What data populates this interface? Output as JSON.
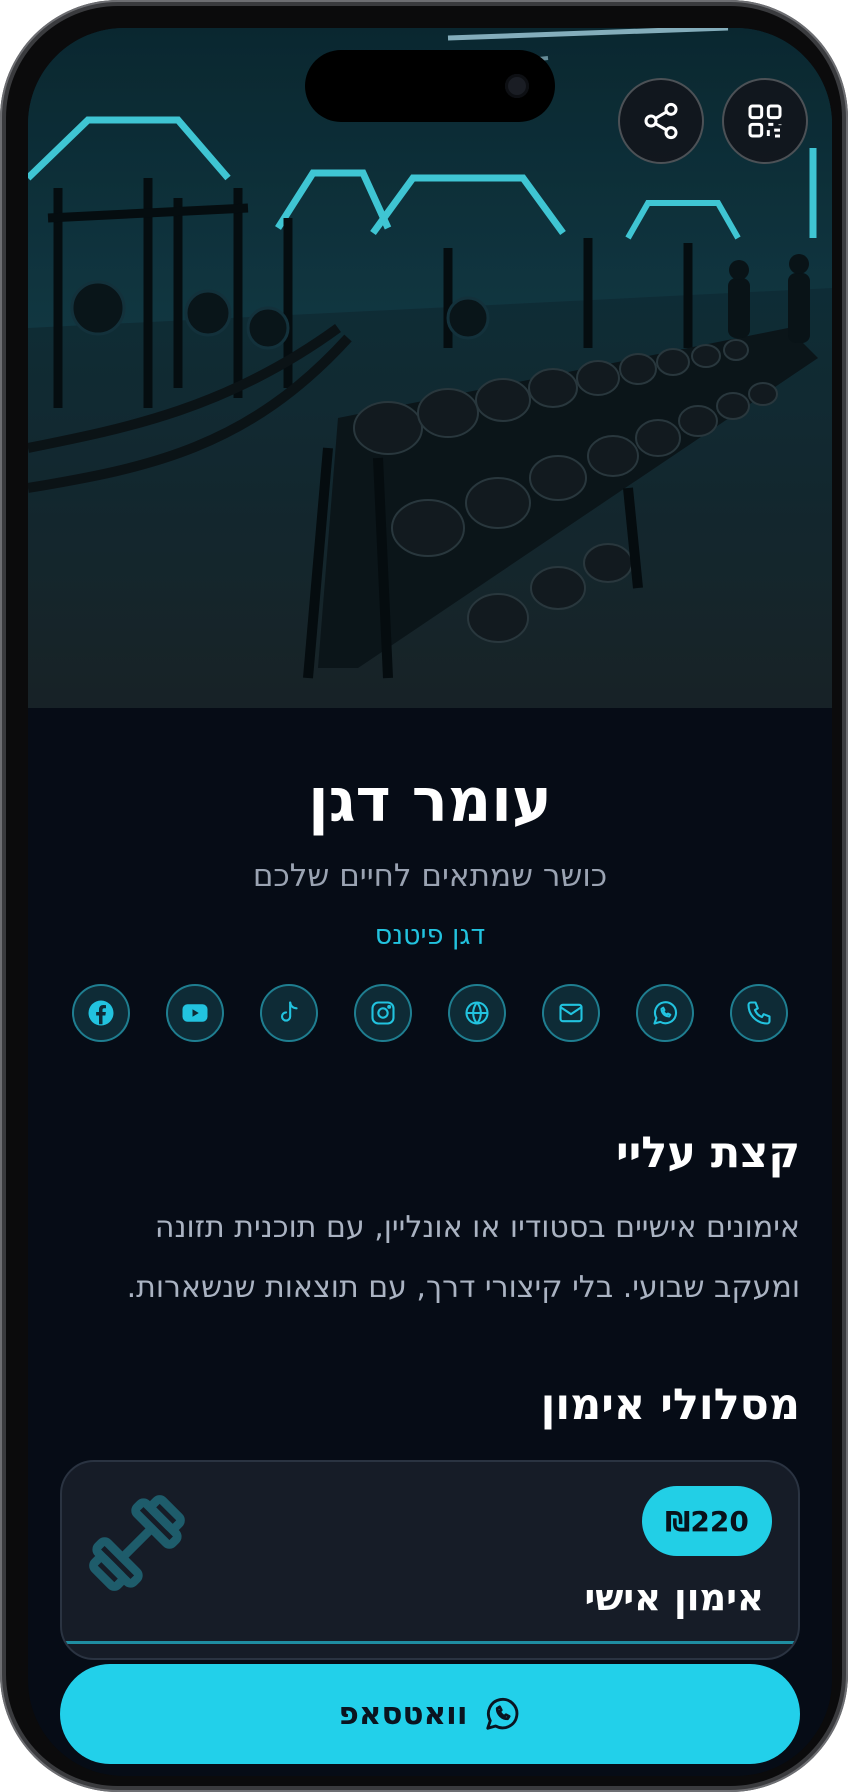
{
  "profile": {
    "name": "עומר דגן",
    "tagline": "כושר שמתאים לחיים שלכם",
    "business": "דגן פיטנס"
  },
  "top_actions": {
    "share_icon": "share-icon",
    "qr_icon": "qr-code-icon"
  },
  "socials": [
    {
      "icon": "phone-icon"
    },
    {
      "icon": "whatsapp-icon"
    },
    {
      "icon": "mail-icon"
    },
    {
      "icon": "globe-icon"
    },
    {
      "icon": "instagram-icon"
    },
    {
      "icon": "tiktok-icon"
    },
    {
      "icon": "youtube-icon"
    },
    {
      "icon": "facebook-icon"
    }
  ],
  "about": {
    "title": "קצת עליי",
    "text": "אימונים אישיים בסטודיו או אונליין, עם תוכנית תזונה ומעקב שבועי. בלי קיצורי דרך, עם תוצאות שנשארות."
  },
  "plans": {
    "title": "מסלולי אימון",
    "items": [
      {
        "name": "אימון אישי",
        "price": "₪220",
        "icon": "dumbbell-icon"
      }
    ]
  },
  "cta": {
    "label": "וואטסאפ",
    "icon": "whatsapp-icon"
  },
  "colors": {
    "accent": "#22d0ea",
    "background": "#060c16",
    "card": "#161c27"
  }
}
